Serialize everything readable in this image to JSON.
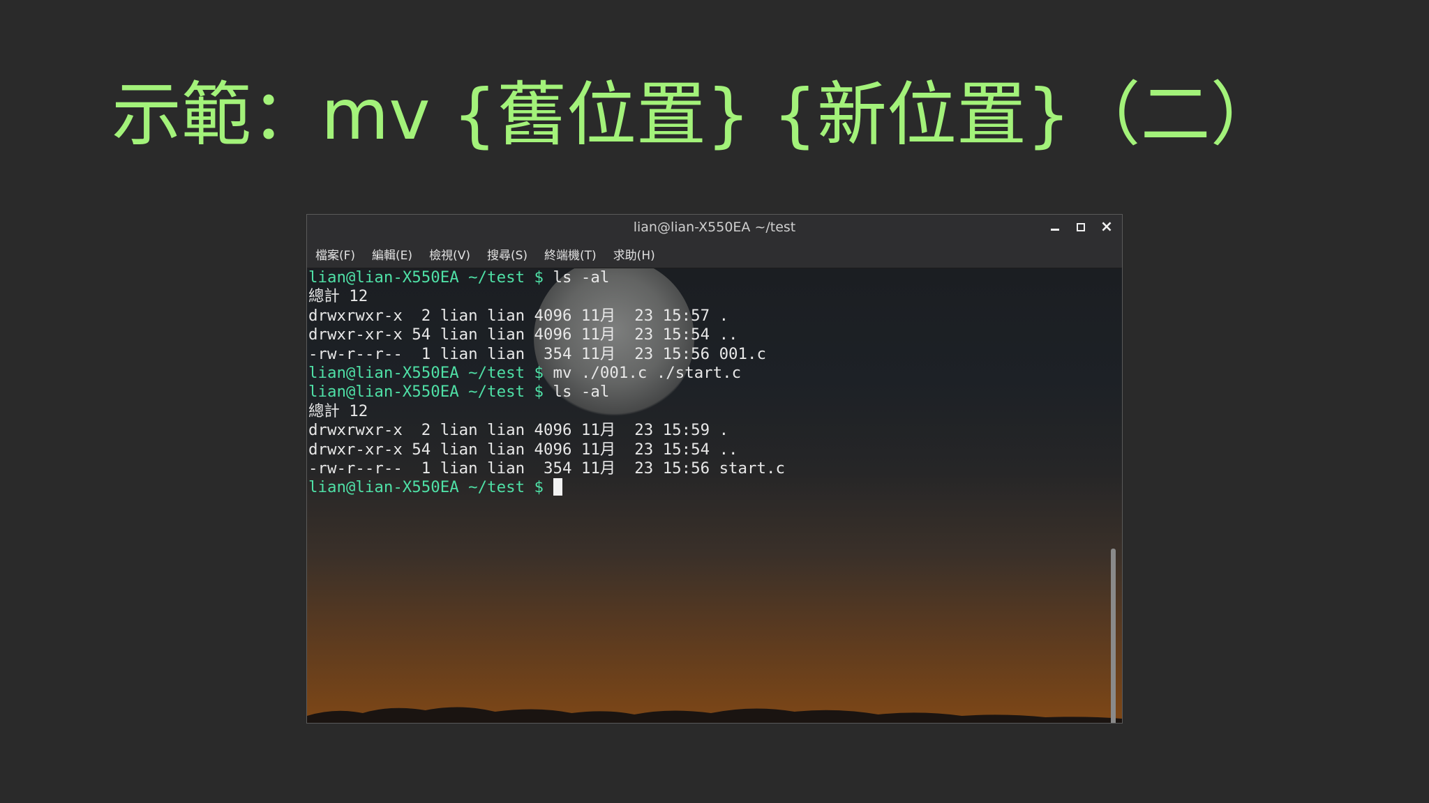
{
  "slide": {
    "title": "示範：mv {舊位置} {新位置}（二）"
  },
  "window": {
    "title": "lian@lian-X550EA ~/test",
    "controls": {
      "minimize": "minimize",
      "maximize": "maximize",
      "close": "×"
    }
  },
  "menu": {
    "items": [
      {
        "label": "檔案(F)"
      },
      {
        "label": "編輯(E)"
      },
      {
        "label": "檢視(V)"
      },
      {
        "label": "搜尋(S)"
      },
      {
        "label": "終端機(T)"
      },
      {
        "label": "求助(H)"
      }
    ]
  },
  "terminal": {
    "prompt": "lian@lian-X550EA ~/test $",
    "lines": [
      {
        "prompt": "lian@lian-X550EA ~/test $",
        "text": " ls -al"
      },
      {
        "text": "總計 12"
      },
      {
        "text": "drwxrwxr-x  2 lian lian 4096 11月  23 15:57 ."
      },
      {
        "text": "drwxr-xr-x 54 lian lian 4096 11月  23 15:54 .."
      },
      {
        "text": "-rw-r--r--  1 lian lian  354 11月  23 15:56 001.c"
      },
      {
        "prompt": "lian@lian-X550EA ~/test $",
        "text": " mv ./001.c ./start.c"
      },
      {
        "prompt": "lian@lian-X550EA ~/test $",
        "text": " ls -al"
      },
      {
        "text": "總計 12"
      },
      {
        "text": "drwxrwxr-x  2 lian lian 4096 11月  23 15:59 ."
      },
      {
        "text": "drwxr-xr-x 54 lian lian 4096 11月  23 15:54 .."
      },
      {
        "text": "-rw-r--r--  1 lian lian  354 11月  23 15:56 start.c"
      },
      {
        "prompt": "lian@lian-X550EA ~/test $",
        "text": " ",
        "cursor": true
      }
    ]
  },
  "colors": {
    "title": "#a3f27a",
    "prompt": "#4fe0a6",
    "output": "#e8e8e8"
  }
}
